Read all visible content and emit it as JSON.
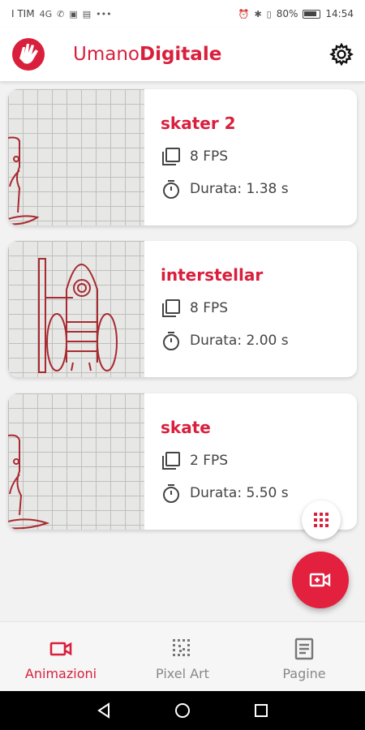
{
  "status_bar": {
    "carrier": "I TIM",
    "network": "4G",
    "battery": "80%",
    "time": "14:54"
  },
  "header": {
    "brand_light": "Umano",
    "brand_bold": "Digitale"
  },
  "animations": [
    {
      "title": "skater 2",
      "fps": "8 FPS",
      "duration": "Durata: 1.38 s",
      "drawing": "skater"
    },
    {
      "title": "interstellar",
      "fps": "8 FPS",
      "duration": "Durata: 2.00 s",
      "drawing": "rocket"
    },
    {
      "title": "skate",
      "fps": "2 FPS",
      "duration": "Durata: 5.50 s",
      "drawing": "skater"
    }
  ],
  "bottom_nav": {
    "items": [
      {
        "label": "Animazioni",
        "icon": "video-camera-icon",
        "active": true
      },
      {
        "label": "Pixel Art",
        "icon": "pixel-grid-icon",
        "active": false
      },
      {
        "label": "Pagine",
        "icon": "document-icon",
        "active": false
      }
    ]
  },
  "colors": {
    "accent": "#d91f3c",
    "fab": "#e3203e",
    "text": "#444444",
    "inactive": "#888888"
  }
}
